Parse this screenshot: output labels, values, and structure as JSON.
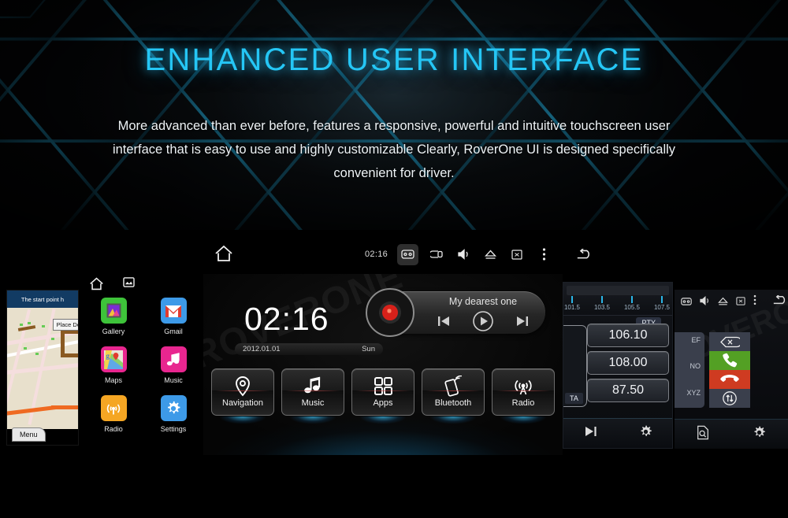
{
  "hero": {
    "title": "ENHANCED USER INTERFACE",
    "subtitle": "More advanced than ever before, features a responsive, powerful and intuitive touchscreen user interface that is easy to use and highly customizable Clearly, RoverOne UI is designed specifically convenient for driver.",
    "accent_color": "#25c6f5"
  },
  "system_bar": {
    "time": "02:16",
    "icons": [
      "home-icon",
      "card-icon",
      "link-icon",
      "volume-icon",
      "eject-icon",
      "close-box-icon",
      "overflow-menu-icon",
      "back-icon"
    ]
  },
  "navigation_panel": {
    "header": "The start point h",
    "place_button": "Place De",
    "menu_button": "Menu"
  },
  "app_drawer": {
    "bar_icons": [
      "home-icon",
      "recents-icon"
    ],
    "apps": [
      {
        "label": "Gallery",
        "color": "#3ec33a"
      },
      {
        "label": "Gmail",
        "color": "#3d9ae8"
      },
      {
        "label": "Maps",
        "color": "#e8268f"
      },
      {
        "label": "Music",
        "color": "#e8268f"
      },
      {
        "label": "Radio",
        "color": "#f5a623"
      },
      {
        "label": "Settings",
        "color": "#3d9ae8"
      }
    ]
  },
  "home": {
    "watermark": "ROVERONE",
    "clock": "02:16",
    "date": "2012.01.01",
    "weekday": "Sun",
    "player": {
      "track": "My dearest one",
      "prev_label": "prev-track",
      "play_label": "play",
      "next_label": "next-track"
    },
    "launcher": [
      {
        "label": "Navigation",
        "icon": "pin-icon"
      },
      {
        "label": "Music",
        "icon": "note-icon"
      },
      {
        "label": "Apps",
        "icon": "grid-icon"
      },
      {
        "label": "Bluetooth",
        "icon": "phone-wave-icon"
      },
      {
        "label": "Radio",
        "icon": "antenna-icon"
      }
    ]
  },
  "radio_panel": {
    "scale_labels": [
      "101.5",
      "103.5",
      "105.5",
      "107.5"
    ],
    "pty_button": "PTY",
    "ta_button": "TA",
    "presets": [
      "106.10",
      "108.00",
      "87.50"
    ],
    "footer_icons": [
      "next-icon",
      "gear-icon"
    ]
  },
  "phone_panel": {
    "watermark": "ROVERONE",
    "sys_icons": [
      "card-icon",
      "volume-icon",
      "eject-icon",
      "close-box-icon",
      "overflow-menu-icon",
      "back-icon"
    ],
    "keypad_letters": [
      "EF",
      "NO",
      "XYZ"
    ],
    "buttons": [
      {
        "name": "delete",
        "glyph": "x",
        "color": "#3a3f4c"
      },
      {
        "name": "answer",
        "glyph": "call",
        "color": "#53a024"
      },
      {
        "name": "hangup",
        "glyph": "endcall",
        "color": "#cf3b21"
      },
      {
        "name": "swap",
        "glyph": "updown",
        "color": "#3a3f4c"
      }
    ],
    "footer_icons": [
      "search-doc-icon",
      "gear-icon"
    ]
  }
}
